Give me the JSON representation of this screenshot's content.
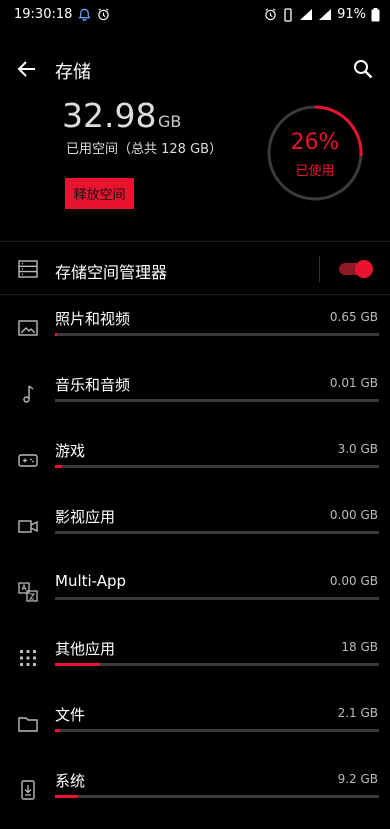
{
  "status_bar": {
    "time": "19:30:18",
    "battery": "91%"
  },
  "header": {
    "title": "存储"
  },
  "summary": {
    "used_value": "32.98",
    "used_unit": "GB",
    "caption": "已用空间（总共 128 GB）",
    "free_button": "释放空间",
    "percent_label": "26%",
    "percent_value": 0.26,
    "used_label": "已使用"
  },
  "manager": {
    "label": "存储空间管理器",
    "enabled": true
  },
  "colors": {
    "accent": "#e8142f",
    "background": "#000000"
  },
  "categories": [
    {
      "label": "照片和视频",
      "size": "0.65 GB",
      "fraction": 0.005,
      "icon": "image-icon"
    },
    {
      "label": "音乐和音频",
      "size": "0.01 GB",
      "fraction": 0.0,
      "icon": "music-note-icon"
    },
    {
      "label": "游戏",
      "size": "3.0 GB",
      "fraction": 0.023,
      "icon": "gamepad-icon"
    },
    {
      "label": "影视应用",
      "size": "0.00 GB",
      "fraction": 0.0,
      "icon": "video-camera-icon"
    },
    {
      "label": "Multi-App",
      "size": "0.00 GB",
      "fraction": 0.0,
      "icon": "multi-app-icon"
    },
    {
      "label": "其他应用",
      "size": "18 GB",
      "fraction": 0.14,
      "icon": "apps-grid-icon"
    },
    {
      "label": "文件",
      "size": "2.1 GB",
      "fraction": 0.016,
      "icon": "folder-icon"
    },
    {
      "label": "系统",
      "size": "9.2 GB",
      "fraction": 0.072,
      "icon": "phone-download-icon"
    }
  ]
}
